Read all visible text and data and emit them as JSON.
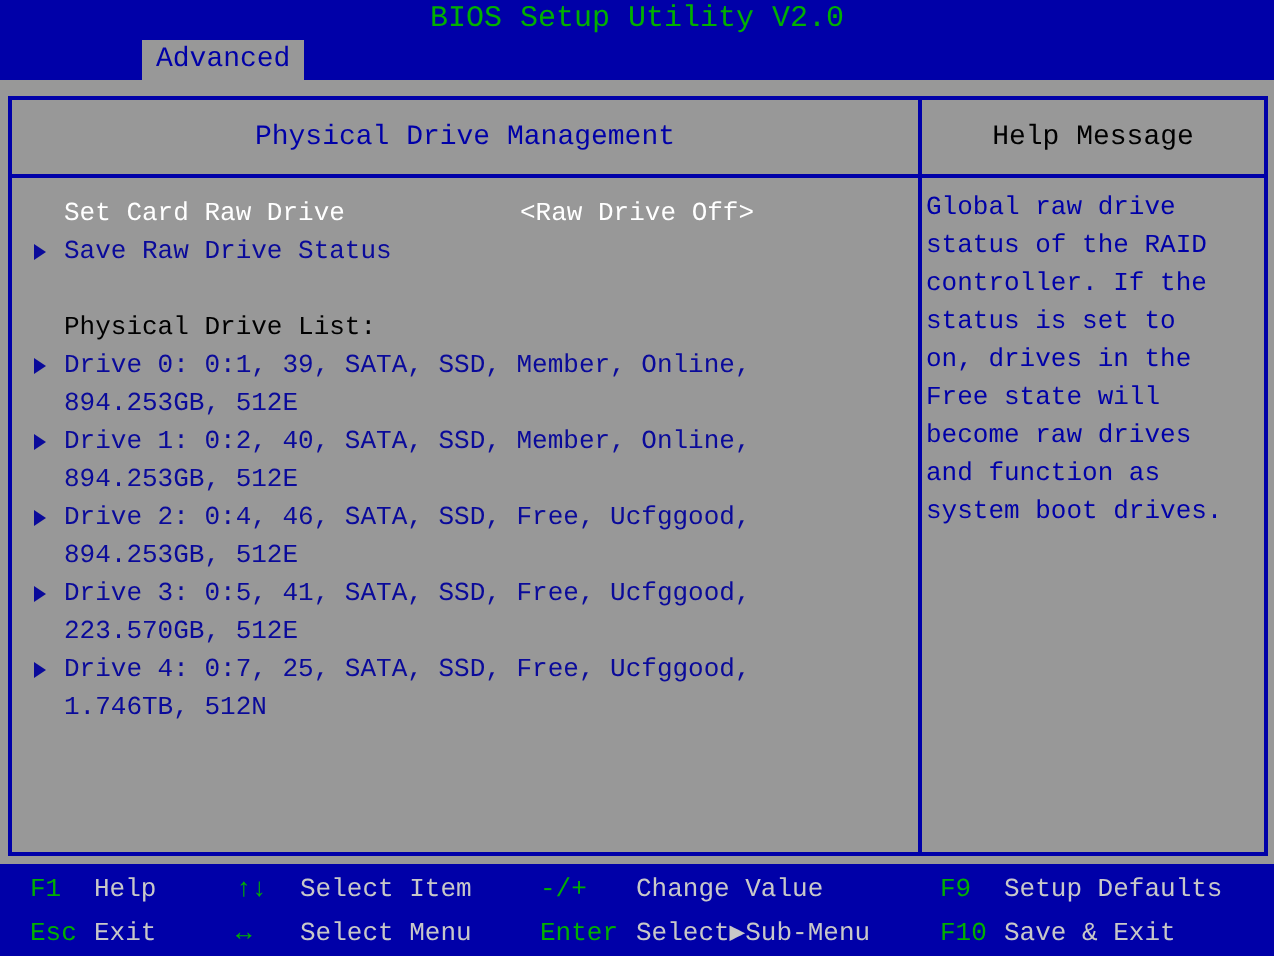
{
  "title": "BIOS Setup Utility V2.0",
  "tabs": [
    {
      "label": "Advanced",
      "selected": true
    }
  ],
  "main_panel": {
    "heading": "Physical Drive Management",
    "items": [
      {
        "kind": "option",
        "label": "Set Card Raw Drive",
        "value": "<Raw Drive Off>",
        "selected": true
      },
      {
        "kind": "submenu",
        "label": "Save Raw Drive Status",
        "selected": false
      },
      {
        "kind": "spacer"
      },
      {
        "kind": "label",
        "label": "Physical Drive List:"
      },
      {
        "kind": "submenu",
        "label": "Drive 0: 0:1, 39, SATA, SSD, Member, Online, 894.253GB, 512E",
        "selected": false
      },
      {
        "kind": "submenu",
        "label": "Drive 1: 0:2, 40, SATA, SSD, Member, Online, 894.253GB, 512E",
        "selected": false
      },
      {
        "kind": "submenu",
        "label": "Drive 2: 0:4, 46, SATA, SSD, Free, Ucfggood, 894.253GB, 512E",
        "selected": false
      },
      {
        "kind": "submenu",
        "label": "Drive 3: 0:5, 41, SATA, SSD, Free, Ucfggood, 223.570GB, 512E",
        "selected": false
      },
      {
        "kind": "submenu",
        "label": "Drive 4: 0:7, 25, SATA, SSD, Free, Ucfggood, 1.746TB, 512N",
        "selected": false
      }
    ]
  },
  "help_panel": {
    "heading": "Help Message",
    "text": "Global raw drive status of the RAID controller. If the status is set to on, drives in the Free state will become raw drives and function as system boot drives."
  },
  "key_legend": [
    {
      "key": "F1",
      "action": "Help"
    },
    {
      "key": "↑↓",
      "action": "Select Item"
    },
    {
      "key": "-/+",
      "action": "Change Value"
    },
    {
      "key": "F9",
      "action": "Setup Defaults"
    },
    {
      "key": "Esc",
      "action": "Exit"
    },
    {
      "key": "↔",
      "action": "Select Menu"
    },
    {
      "key": "Enter",
      "action": "Select▶Sub-Menu"
    },
    {
      "key": "F10",
      "action": "Save & Exit"
    }
  ]
}
